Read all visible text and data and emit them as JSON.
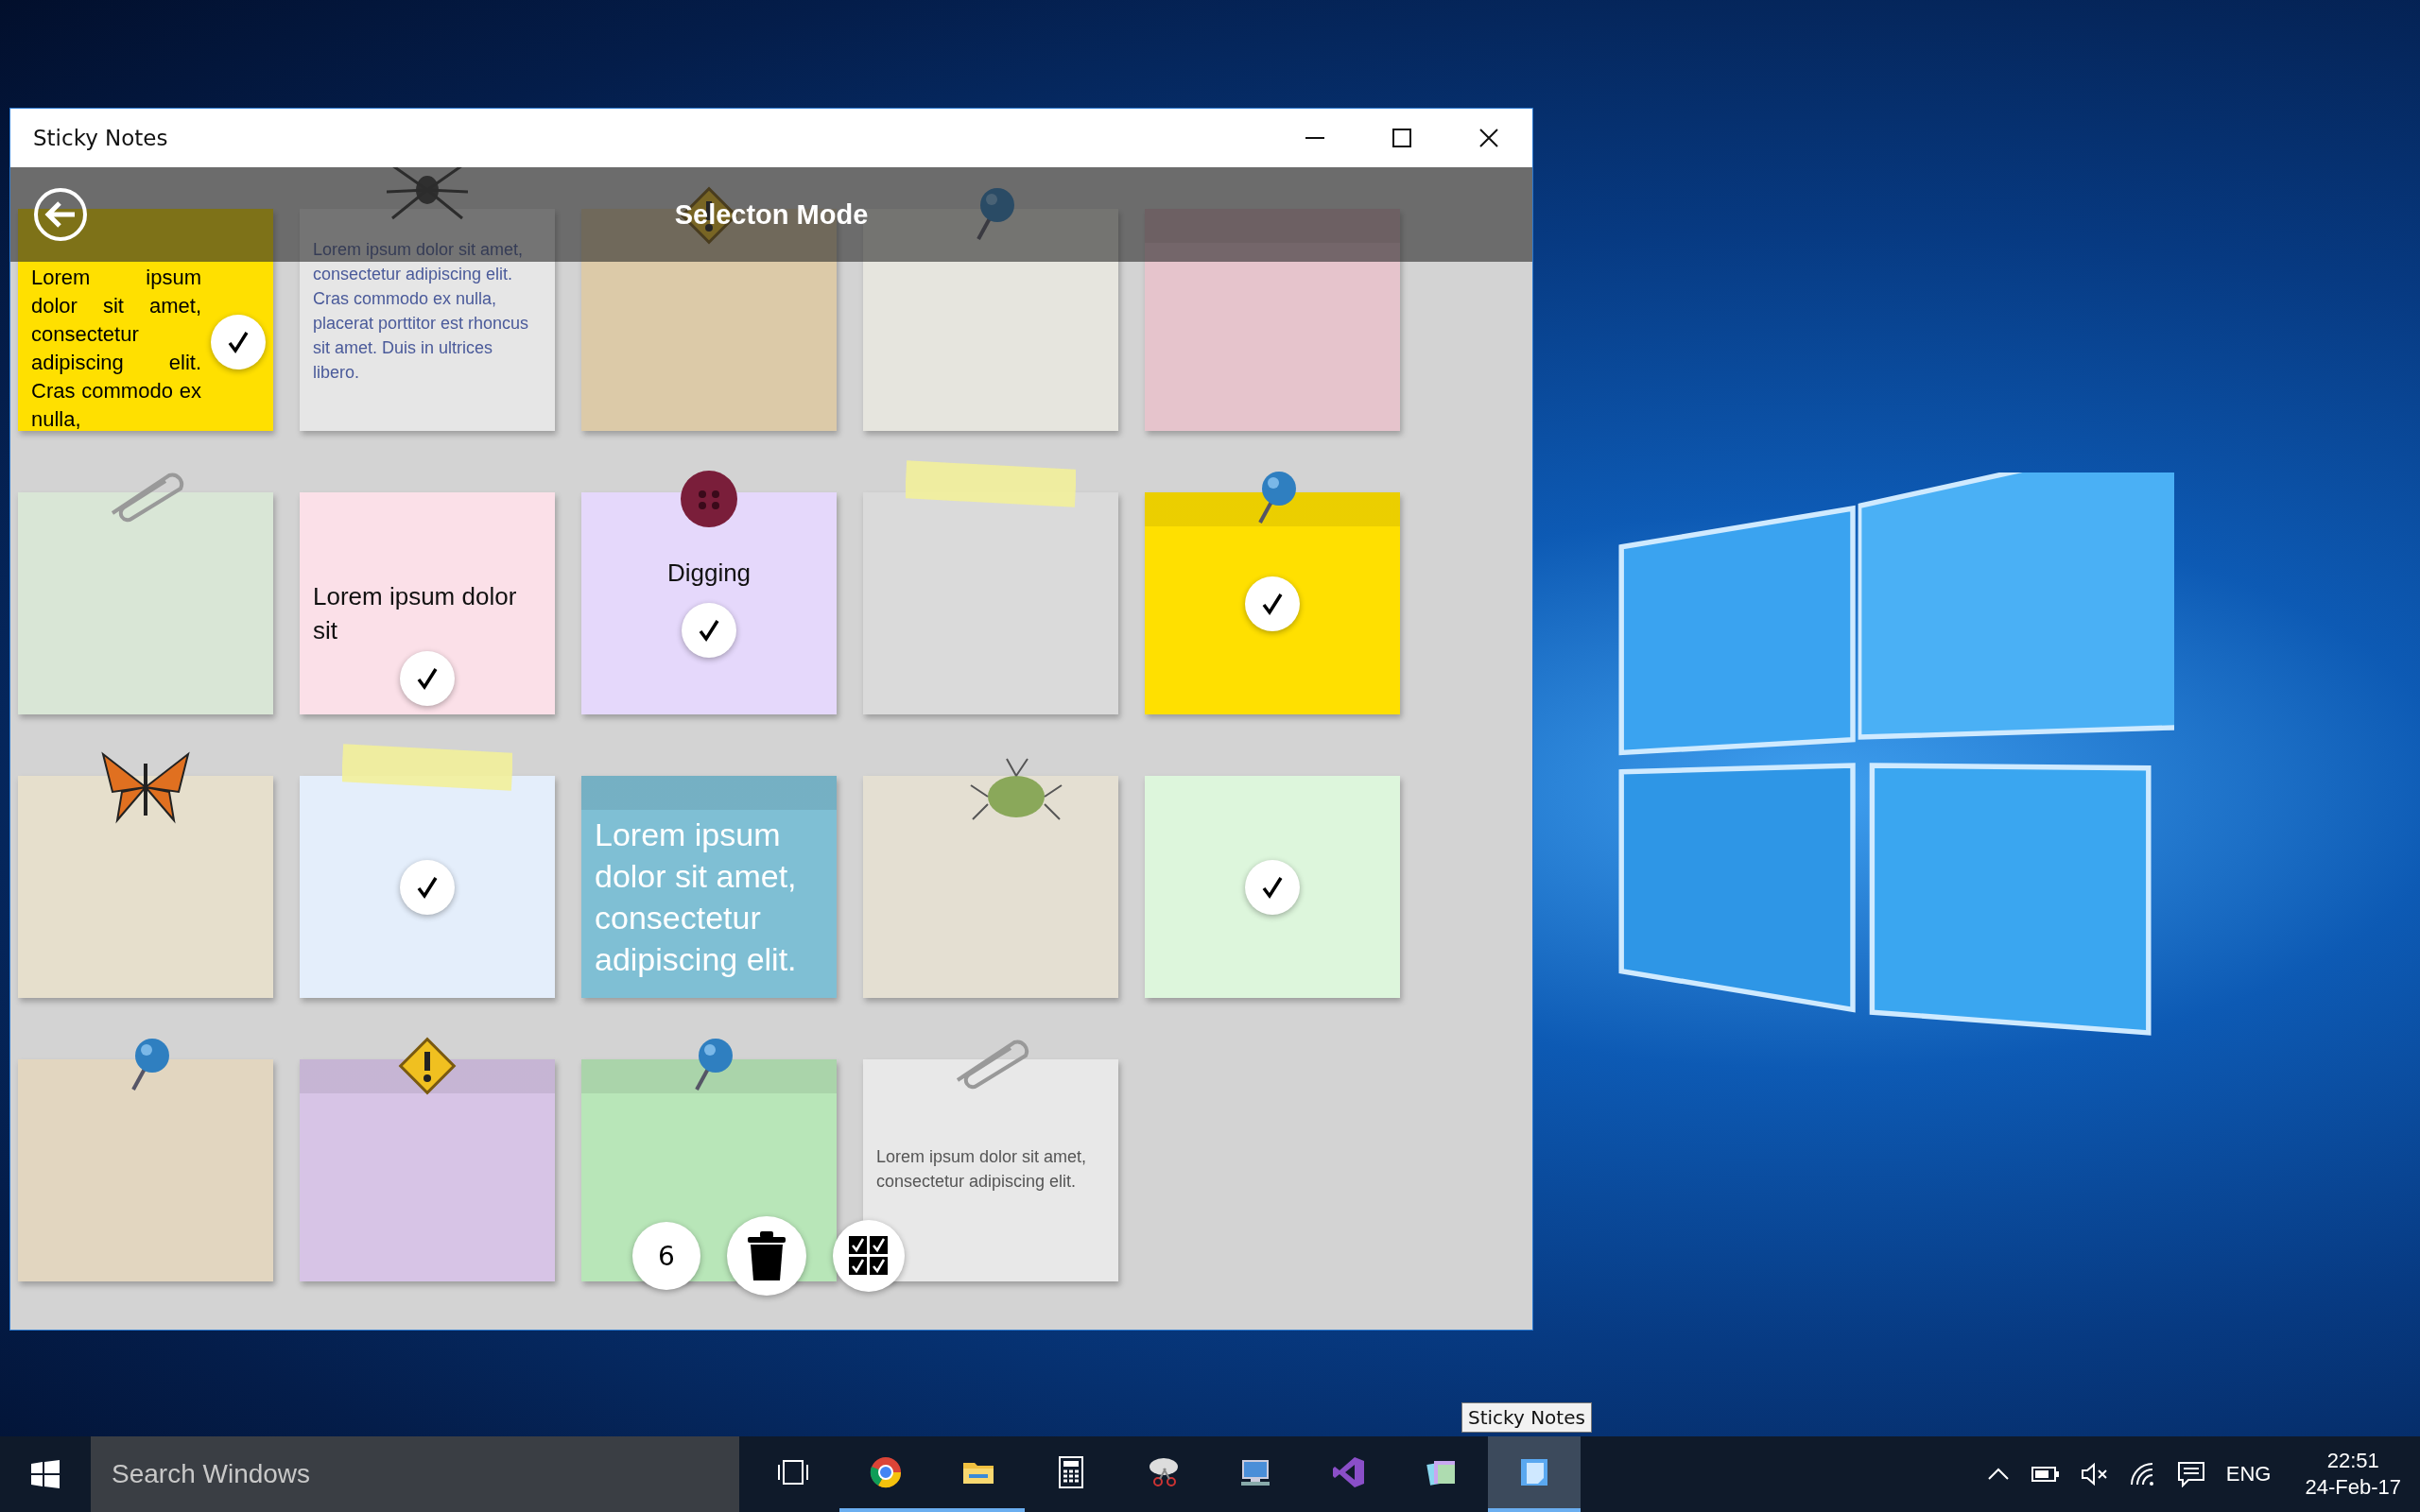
{
  "window": {
    "title": "Sticky Notes"
  },
  "header": {
    "title": "Selecton Mode"
  },
  "notes": [
    {
      "color": "#ffe000",
      "text": "Lorem ipsum dolor sit amet, consectetur adipiscing elit. Cras commodo ex nulla,",
      "kind": "plain",
      "selected": true
    },
    {
      "color": "#e6e6e6",
      "text": "Lorem ipsum dolor sit amet, consectetur adipiscing elit. Cras commodo ex nulla, placerat porttitor est rhoncus sit amet. Duis in ultrices libero.",
      "kind": "spider",
      "selected": false
    },
    {
      "color": "#dccaa8",
      "kind": "warning",
      "selected": false
    },
    {
      "color": "#e6e5de",
      "kind": "pin",
      "selected": false
    },
    {
      "color": "#e6c4cc",
      "kind": "plain",
      "selected": false
    },
    {
      "color": "#d9e6d6",
      "kind": "clip",
      "selected": false
    },
    {
      "color": "#fbe0e8",
      "text": "Lorem ipsum dolor sit",
      "kind": "plain",
      "selected": true
    },
    {
      "color": "#e5d8fb",
      "text": "Digging",
      "kind": "button",
      "selected": true
    },
    {
      "color": "#dadada",
      "kind": "tape",
      "selected": false
    },
    {
      "color": "#ffe000",
      "kind": "pin",
      "selected": true
    },
    {
      "color": "#e6dfcc",
      "kind": "butterfly",
      "selected": false
    },
    {
      "color": "#e4eefb",
      "kind": "tape",
      "selected": true
    },
    {
      "color": "#7fbfd4",
      "text": "Lorem ipsum dolor sit amet, consectetur adipiscing elit.",
      "kind": "plain",
      "selected": false
    },
    {
      "color": "#e4dfd2",
      "kind": "bug",
      "selected": false
    },
    {
      "color": "#ddf6dc",
      "kind": "plain",
      "selected": true
    },
    {
      "color": "#e2d6c0",
      "kind": "pin",
      "selected": false
    },
    {
      "color": "#d7c4e6",
      "kind": "warning",
      "selected": false
    },
    {
      "color": "#b8e6b8",
      "kind": "pin",
      "selected": false
    },
    {
      "color": "#e8e8e8",
      "text": "Lorem ipsum dolor sit amet, consectetur adipiscing elit.",
      "kind": "clip",
      "selected": false
    }
  ],
  "selection_count": "6",
  "tooltip": "Sticky Notes",
  "taskbar": {
    "search_placeholder": "Search Windows",
    "apps": [
      {
        "kind": "taskview",
        "running": false,
        "active": false
      },
      {
        "kind": "browser",
        "running": true,
        "active": false
      },
      {
        "kind": "folder",
        "running": true,
        "active": false
      },
      {
        "kind": "calculator",
        "running": false,
        "active": false
      },
      {
        "kind": "scissors",
        "running": false,
        "active": false
      },
      {
        "kind": "monitor",
        "running": false,
        "active": false
      },
      {
        "kind": "studio",
        "running": false,
        "active": false
      },
      {
        "kind": "notes",
        "running": false,
        "active": false
      },
      {
        "kind": "note",
        "running": true,
        "active": true
      }
    ],
    "language": "ENG",
    "time": "22:51",
    "date": "24-Feb-17"
  }
}
